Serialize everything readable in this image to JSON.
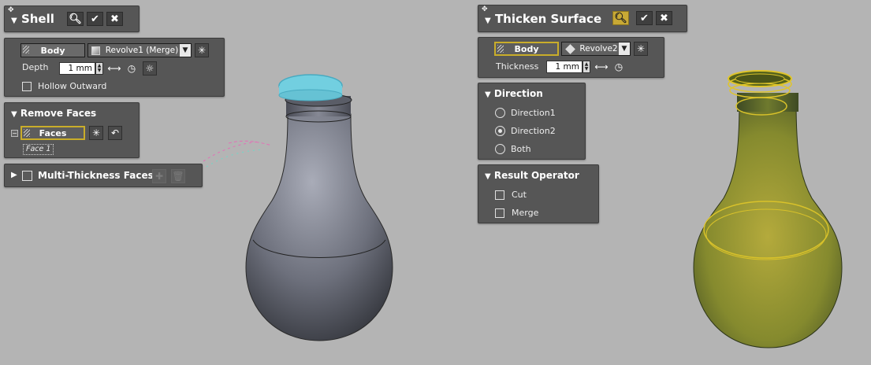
{
  "shell": {
    "title": "Shell",
    "body_button": "Body",
    "body_dropdown": "Revolve1 (Merge)",
    "depth_label": "Depth",
    "depth_value": "1 mm",
    "hollow_outward_label": "Hollow Outward",
    "hollow_outward_checked": false
  },
  "remove_faces": {
    "title": "Remove Faces",
    "faces_button": "Faces",
    "selected_face": "Face 1"
  },
  "multi_thickness": {
    "title": "Multi-Thickness Faces",
    "checked": false
  },
  "thicken": {
    "title": "Thicken Surface",
    "body_button": "Body",
    "body_dropdown": "Revolve2",
    "thickness_label": "Thickness",
    "thickness_value": "1 mm"
  },
  "direction": {
    "title": "Direction",
    "options": [
      "Direction1",
      "Direction2",
      "Both"
    ],
    "selected": "Direction2"
  },
  "result_operator": {
    "title": "Result Operator",
    "options": [
      "Cut",
      "Merge"
    ]
  },
  "colors": {
    "background": "#b4b4b4",
    "panel": "#565656",
    "selection_highlight": "#c9ad2a",
    "face_highlight": "#55c8d8",
    "thicken_body": "#8f9a2e"
  }
}
